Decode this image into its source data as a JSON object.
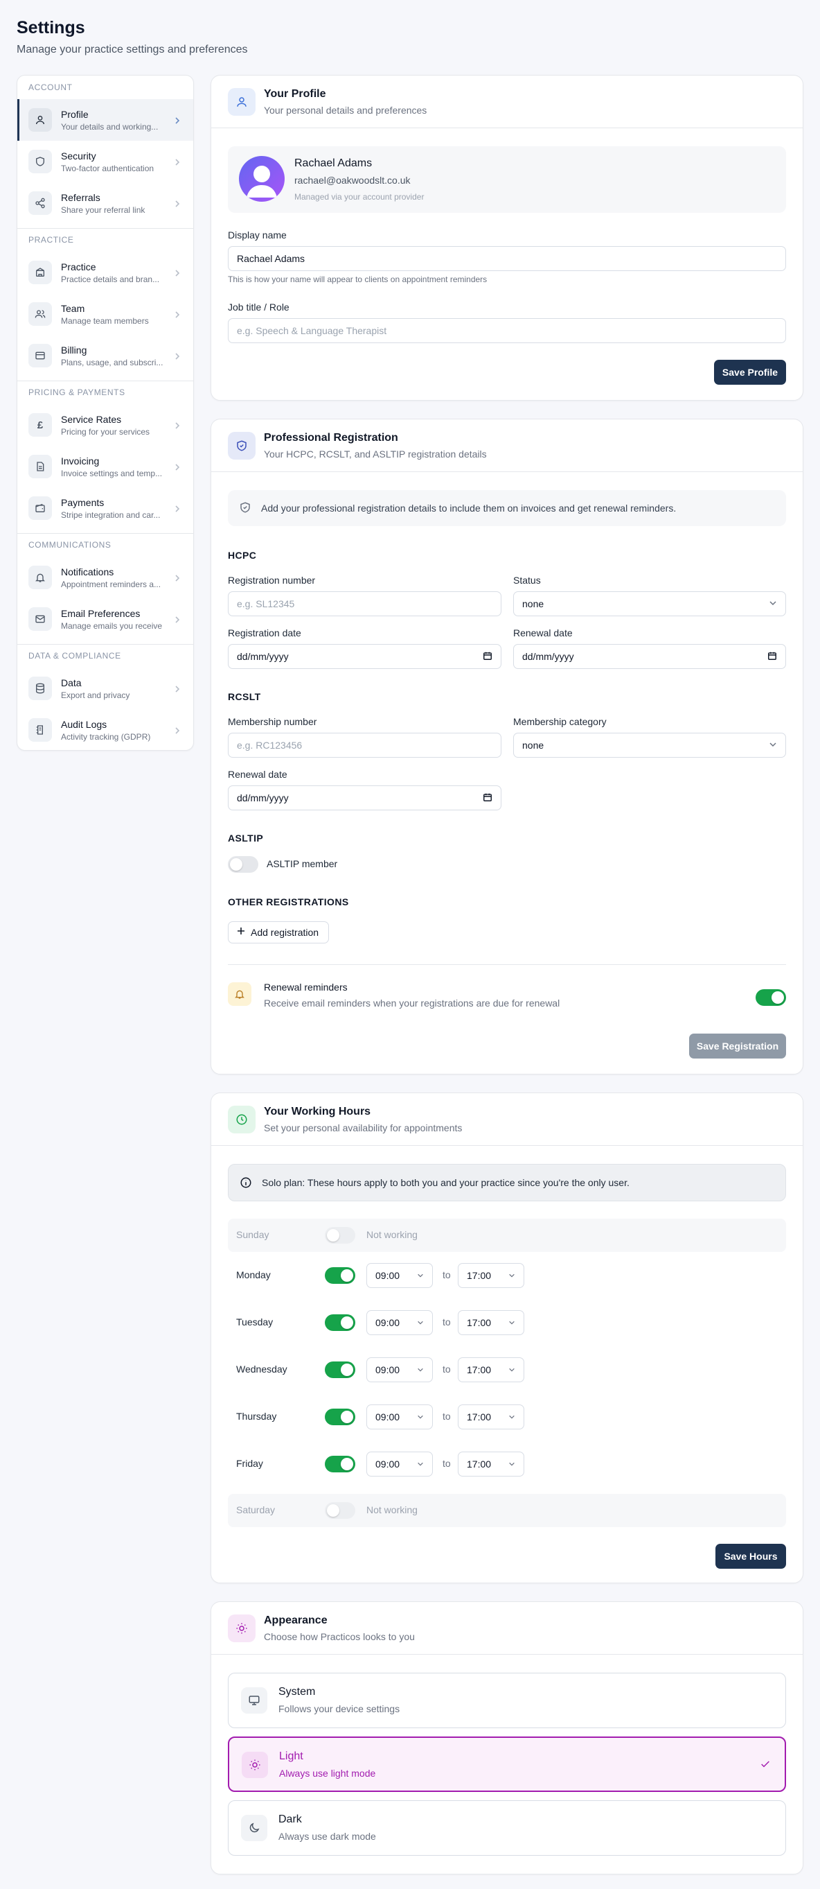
{
  "page": {
    "title": "Settings",
    "subtitle": "Manage your practice settings and preferences"
  },
  "sidebar": {
    "groups": [
      {
        "heading": "ACCOUNT",
        "items": [
          {
            "label": "Profile",
            "desc": "Your details and working...",
            "icon": "user-icon",
            "active": true
          },
          {
            "label": "Security",
            "desc": "Two-factor authentication",
            "icon": "shield-icon"
          },
          {
            "label": "Referrals",
            "desc": "Share your referral link",
            "icon": "share-icon"
          }
        ]
      },
      {
        "heading": "PRACTICE",
        "items": [
          {
            "label": "Practice",
            "desc": "Practice details and bran...",
            "icon": "building-icon"
          },
          {
            "label": "Team",
            "desc": "Manage team members",
            "icon": "users-icon"
          },
          {
            "label": "Billing",
            "desc": "Plans, usage, and subscri...",
            "icon": "credit-card-icon"
          }
        ]
      },
      {
        "heading": "PRICING & PAYMENTS",
        "items": [
          {
            "label": "Service Rates",
            "desc": "Pricing for your services",
            "icon": "pound-icon"
          },
          {
            "label": "Invoicing",
            "desc": "Invoice settings and temp...",
            "icon": "document-icon"
          },
          {
            "label": "Payments",
            "desc": "Stripe integration and car...",
            "icon": "wallet-icon"
          }
        ]
      },
      {
        "heading": "COMMUNICATIONS",
        "items": [
          {
            "label": "Notifications",
            "desc": "Appointment reminders a...",
            "icon": "bell-icon"
          },
          {
            "label": "Email Preferences",
            "desc": "Manage emails you receive",
            "icon": "mail-icon"
          }
        ]
      },
      {
        "heading": "DATA & COMPLIANCE",
        "items": [
          {
            "label": "Data",
            "desc": "Export and privacy",
            "icon": "database-icon"
          },
          {
            "label": "Audit Logs",
            "desc": "Activity tracking (GDPR)",
            "icon": "log-icon"
          }
        ]
      }
    ]
  },
  "profile": {
    "title": "Your Profile",
    "subtitle": "Your personal details and preferences",
    "name": "Rachael Adams",
    "email": "rachael@oakwoodslt.co.uk",
    "managed_note": "Managed via your account provider",
    "display_name_label": "Display name",
    "display_name_value": "Rachael Adams",
    "display_name_help": "This is how your name will appear to clients on appointment reminders",
    "job_title_label": "Job title / Role",
    "job_title_placeholder": "e.g. Speech & Language Therapist",
    "save_label": "Save Profile"
  },
  "registration": {
    "title": "Professional Registration",
    "subtitle": "Your HCPC, RCSLT, and ASLTIP registration details",
    "info": "Add your professional registration details to include them on invoices and get renewal reminders.",
    "hcpc": {
      "heading": "HCPC",
      "reg_number_label": "Registration number",
      "reg_number_placeholder": "e.g. SL12345",
      "status_label": "Status",
      "status_value": "none",
      "reg_date_label": "Registration date",
      "renewal_date_label": "Renewal date",
      "date_placeholder": "dd/mm/yyyy"
    },
    "rcslt": {
      "heading": "RCSLT",
      "membership_number_label": "Membership number",
      "membership_number_placeholder": "e.g. RC123456",
      "membership_category_label": "Membership category",
      "membership_category_value": "none",
      "renewal_date_label": "Renewal date",
      "date_placeholder": "dd/mm/yyyy"
    },
    "asltip": {
      "heading": "ASLTIP",
      "toggle_label": "ASLTIP member",
      "on": false
    },
    "other": {
      "heading": "OTHER REGISTRATIONS",
      "add_label": "Add registration"
    },
    "reminders": {
      "title": "Renewal reminders",
      "desc": "Receive email reminders when your registrations are due for renewal",
      "on": true
    },
    "save_label": "Save Registration"
  },
  "hours": {
    "title": "Your Working Hours",
    "subtitle": "Set your personal availability for appointments",
    "info": "Solo plan: These hours apply to both you and your practice since you're the only user.",
    "not_working_label": "Not working",
    "to_label": "to",
    "days": [
      {
        "name": "Sunday",
        "on": false
      },
      {
        "name": "Monday",
        "on": true,
        "start": "09:00",
        "end": "17:00"
      },
      {
        "name": "Tuesday",
        "on": true,
        "start": "09:00",
        "end": "17:00"
      },
      {
        "name": "Wednesday",
        "on": true,
        "start": "09:00",
        "end": "17:00"
      },
      {
        "name": "Thursday",
        "on": true,
        "start": "09:00",
        "end": "17:00"
      },
      {
        "name": "Friday",
        "on": true,
        "start": "09:00",
        "end": "17:00"
      },
      {
        "name": "Saturday",
        "on": false
      }
    ],
    "save_label": "Save Hours"
  },
  "appearance": {
    "title": "Appearance",
    "subtitle": "Choose how Practicos looks to you",
    "options": [
      {
        "label": "System",
        "desc": "Follows your device settings",
        "icon": "monitor-icon",
        "selected": false
      },
      {
        "label": "Light",
        "desc": "Always use light mode",
        "icon": "sun-icon",
        "selected": true
      },
      {
        "label": "Dark",
        "desc": "Always use dark mode",
        "icon": "moon-icon",
        "selected": false
      }
    ]
  },
  "colors": {
    "primary": "#1e3350",
    "success": "#16a34a",
    "accent": "#a21caf"
  }
}
